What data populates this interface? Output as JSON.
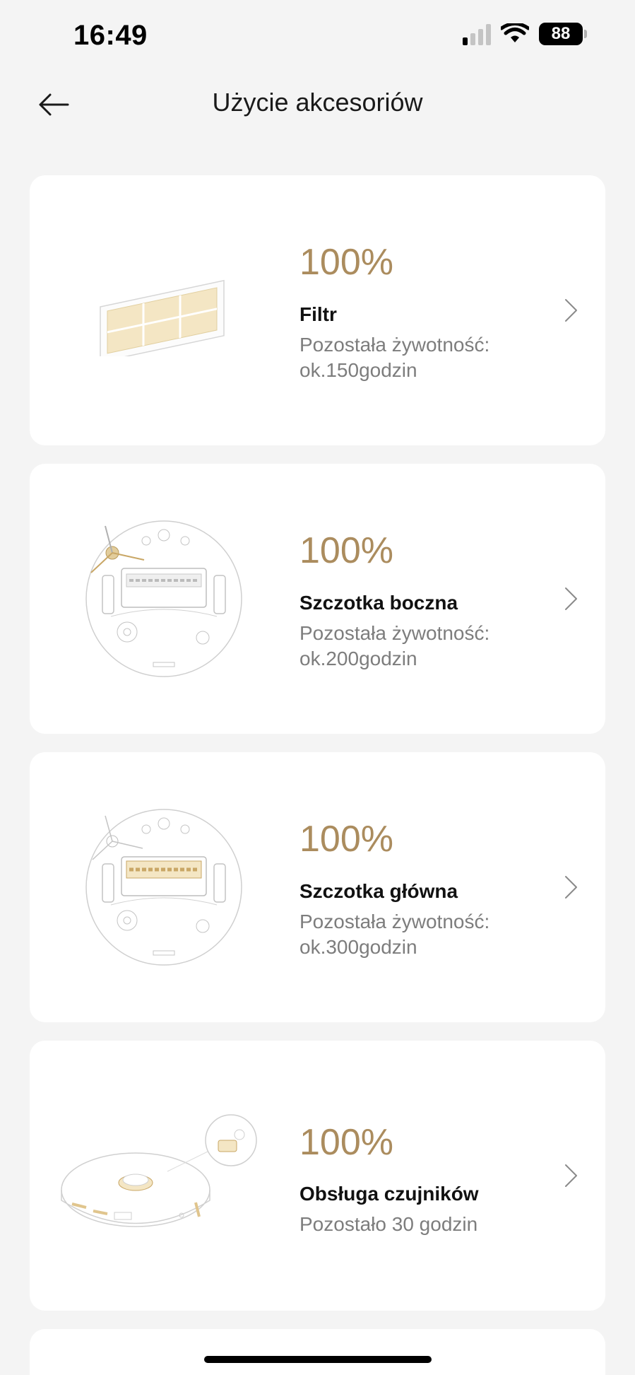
{
  "status_bar": {
    "time": "16:49",
    "battery": "88"
  },
  "header": {
    "title": "Użycie akcesoriów",
    "back_icon": "arrow-left-icon"
  },
  "accessories": [
    {
      "percent": "100%",
      "name": "Filtr",
      "detail": "Pozostała żywotność: ok.150godzin",
      "image": "filter-image"
    },
    {
      "percent": "100%",
      "name": "Szczotka boczna",
      "detail": "Pozostała żywotność: ok.200godzin",
      "image": "robot-bottom-side-brush-image"
    },
    {
      "percent": "100%",
      "name": "Szczotka główna",
      "detail": "Pozostała żywotność: ok.300godzin",
      "image": "robot-bottom-main-brush-image"
    },
    {
      "percent": "100%",
      "name": "Obsługa czujników",
      "detail": "Pozostało 30 godzin",
      "image": "robot-sensors-image"
    }
  ],
  "colors": {
    "accent": "#ab8c5e",
    "background": "#f4f4f4",
    "card": "#ffffff",
    "secondary_text": "#7d7d7d"
  }
}
